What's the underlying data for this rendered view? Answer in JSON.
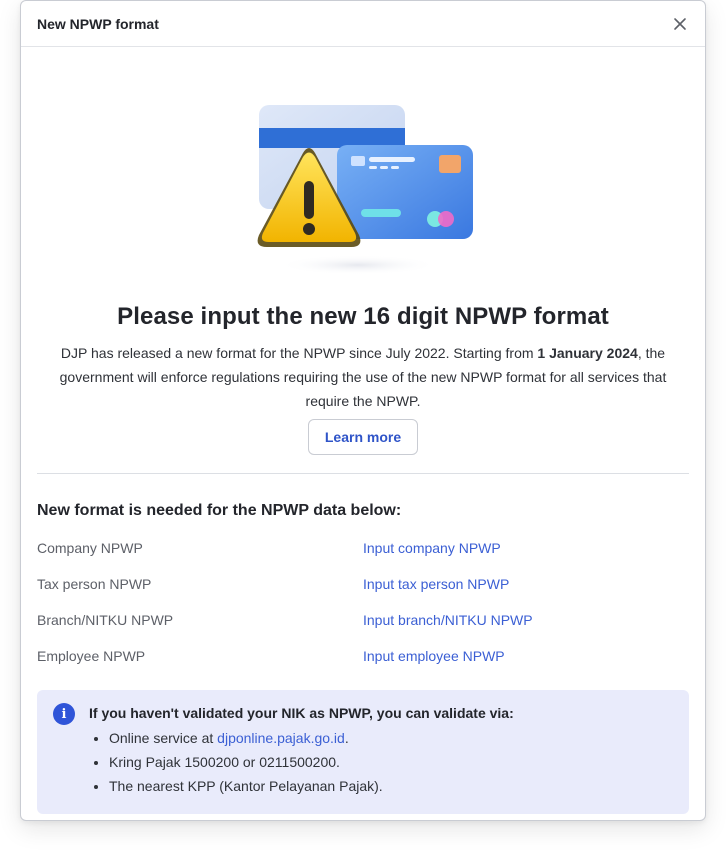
{
  "modal": {
    "title": "New NPWP format"
  },
  "hero": {
    "headline": "Please input the new 16 digit NPWP format",
    "desc_part1": "DJP has released a new format for the NPWP since July 2022. Starting from ",
    "desc_bold": "1 January 2024",
    "desc_part2": ", the government will enforce regulations requiring the use of the new NPWP format for all services that require the NPWP.",
    "learn_more": "Learn more"
  },
  "section": {
    "title": "New format is needed for the NPWP data below:",
    "rows": [
      {
        "label": "Company NPWP",
        "link": "Input company NPWP"
      },
      {
        "label": "Tax person NPWP",
        "link": "Input tax person NPWP"
      },
      {
        "label": "Branch/NITKU NPWP",
        "link": "Input branch/NITKU NPWP"
      },
      {
        "label": "Employee NPWP",
        "link": "Input employee NPWP"
      }
    ]
  },
  "info": {
    "icon": "info-icon",
    "title": "If you haven't validated your NIK as NPWP, you can validate via:",
    "item1_prefix": "Online service at ",
    "item1_link": "djponline.pajak.go.id",
    "item1_suffix": ".",
    "item2": "Kring Pajak 1500200 or 0211500200.",
    "item3": "The nearest KPP (Kantor Pelayanan Pajak)."
  },
  "colors": {
    "accent": "#3b5fd4",
    "info_bg": "#e9ebfb",
    "warning": "#f5c518"
  }
}
